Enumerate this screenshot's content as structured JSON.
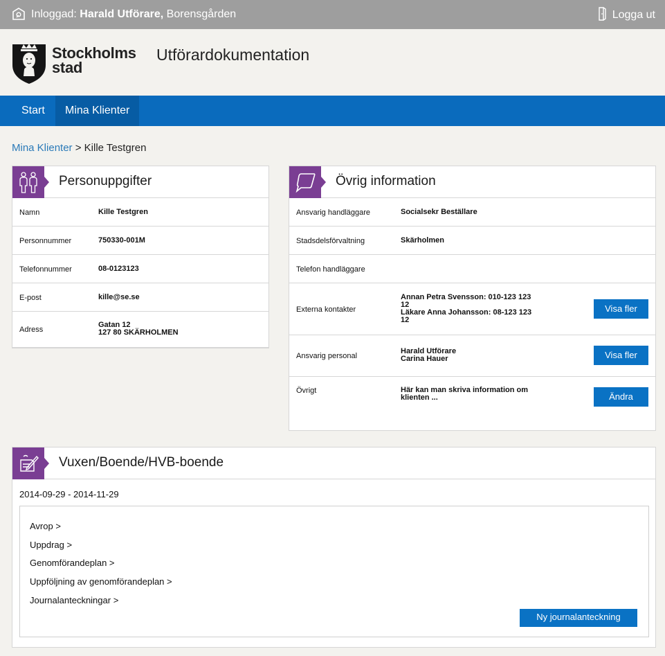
{
  "topbar": {
    "login_prefix": "Inloggad:",
    "user_name": "Harald Utförare,",
    "unit": "Borensgården",
    "logout_label": "Logga ut"
  },
  "header": {
    "logo_line1": "Stockholms",
    "logo_line2": "stad",
    "app_title": "Utförardokumentation"
  },
  "nav": {
    "start": "Start",
    "clients": "Mina Klienter"
  },
  "breadcrumb": {
    "parent": "Mina Klienter",
    "separator": ">",
    "current": "Kille Testgren"
  },
  "personal": {
    "title": "Personuppgifter",
    "rows": [
      {
        "label": "Namn",
        "value": "Kille Testgren"
      },
      {
        "label": "Personnummer",
        "value": "750330-001M"
      },
      {
        "label": "Telefonnummer",
        "value": "08-0123123"
      },
      {
        "label": "E-post",
        "value": "kille@se.se"
      },
      {
        "label": "Adress",
        "value_line1": "Gatan 12",
        "value_line2": "127 80 SKÄRHOLMEN"
      }
    ]
  },
  "other": {
    "title": "Övrig information",
    "ansvarig_label": "Ansvarig handläggare",
    "ansvarig_value": "Socialsekr Beställare",
    "stadsdel_label": "Stadsdelsförvaltning",
    "stadsdel_value": "Skärholmen",
    "telefon_label": "Telefon handläggare",
    "telefon_value": "",
    "externa_label": "Externa kontakter",
    "externa_line1": "Annan Petra Svensson: 010-123 123",
    "externa_line2": "12",
    "externa_line3": "Läkare Anna Johansson: 08-123 123",
    "externa_line4": "12",
    "personal_label": "Ansvarig personal",
    "personal_line1": "Harald Utförare",
    "personal_line2": "Carina Hauer",
    "ovrigt_label": "Övrigt",
    "ovrigt_line1": "Här kan man skriva information om",
    "ovrigt_line2": "klienten ...",
    "show_more": "Visa fler",
    "edit": "Ändra"
  },
  "service": {
    "title": "Vuxen/Boende/HVB-boende",
    "period": "2014-09-29 - 2014-11-29",
    "links": [
      "Avrop >",
      "Uppdrag >",
      "Genomförandeplan >",
      "Uppföljning av genomförandeplan >",
      "Journalanteckningar >"
    ],
    "new_note": "Ny journalanteckning"
  },
  "colors": {
    "topbar": "#9e9e9e",
    "nav": "#0a6bbd",
    "accent_purple": "#7a3e93",
    "button": "#0a72c4",
    "link": "#2a7ab8"
  }
}
